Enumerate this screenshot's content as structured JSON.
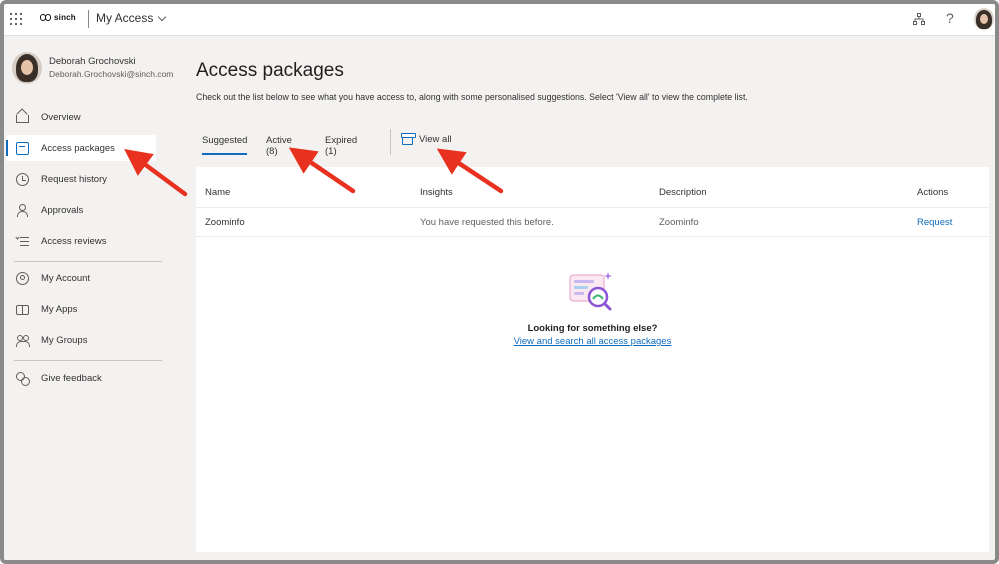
{
  "topbar": {
    "brand": "sinch",
    "app_name": "My Access"
  },
  "profile": {
    "name": "Deborah Grochovski",
    "email": "Deborah.Grochovski@sinch.com"
  },
  "nav": {
    "overview": "Overview",
    "access_packages": "Access packages",
    "request_history": "Request history",
    "approvals": "Approvals",
    "access_reviews": "Access reviews",
    "my_account": "My Account",
    "my_apps": "My Apps",
    "my_groups": "My Groups",
    "give_feedback": "Give feedback"
  },
  "main": {
    "title": "Access packages",
    "description": "Check out the list below to see what you have access to, along with some personalised suggestions. Select 'View all' to view the complete list.",
    "tabs": {
      "suggested": "Suggested",
      "active": "Active (8)",
      "expired": "Expired (1)"
    },
    "view_all": "View all"
  },
  "table": {
    "headers": {
      "name": "Name",
      "insights": "Insights",
      "description": "Description",
      "actions": "Actions"
    },
    "rows": [
      {
        "name": "Zoominfo",
        "insights": "You have requested this before.",
        "description": "Zoominfo",
        "action": "Request"
      }
    ]
  },
  "empty_state": {
    "title": "Looking for something else?",
    "link": "View and search all access packages"
  },
  "colors": {
    "accent": "#0f6cbd",
    "annotation_arrow": "#e8321f",
    "sidebar_bg": "#f3f2f1"
  }
}
